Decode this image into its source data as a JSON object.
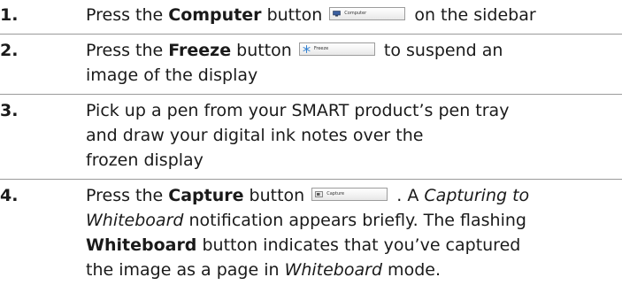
{
  "steps": [
    {
      "number": "1.",
      "parts": {
        "a": "Press the ",
        "b": "Computer",
        "c": " button ",
        "button_label": "Computer",
        "d": " on the sidebar"
      }
    },
    {
      "number": "2.",
      "parts": {
        "a": "Press the ",
        "b": "Freeze",
        "c": " button ",
        "button_label": "Freeze",
        "d": " to suspend an",
        "e": "image of the display"
      }
    },
    {
      "number": "3.",
      "parts": {
        "a": "Pick up a pen from your SMART product’s pen tray",
        "b": "and draw your digital ink notes over the",
        "c": "frozen display"
      }
    },
    {
      "number": "4.",
      "parts": {
        "a": "Press the ",
        "b": "Capture",
        "c": " button ",
        "button_label": "Capture",
        "d": " . A ",
        "e": "Capturing to",
        "f": "Whiteboard",
        "g": " notification appears briefly. The flashing",
        "h": "Whiteboard",
        "i": " button indicates that you’ve captured",
        "j": "the image as a page in ",
        "k": "Whiteboard",
        "l": " mode."
      }
    }
  ],
  "icons": {
    "computer": "monitor-icon",
    "freeze": "snowflake-icon",
    "capture": "camera-icon"
  },
  "colors": {
    "text": "#1a1a1a",
    "divider": "#9a9a9a",
    "freeze_icon": "#2f7fd0"
  }
}
